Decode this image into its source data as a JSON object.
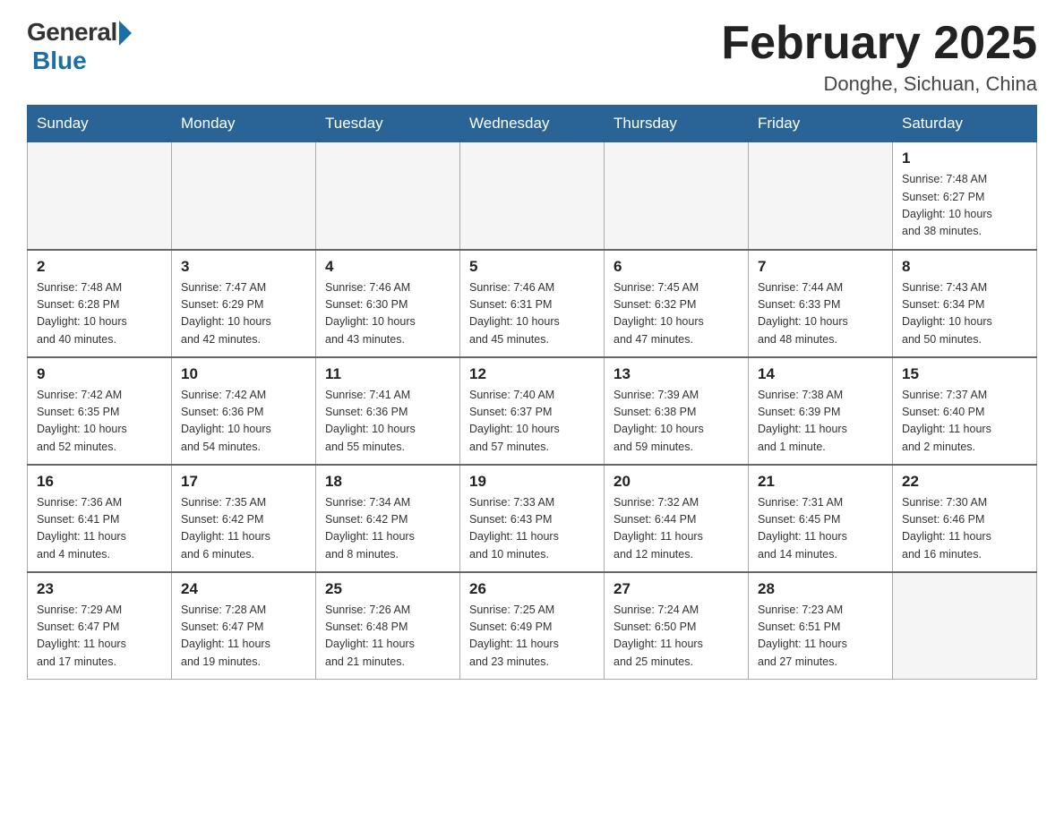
{
  "header": {
    "logo_general": "General",
    "logo_blue": "Blue",
    "title": "February 2025",
    "subtitle": "Donghe, Sichuan, China"
  },
  "days_of_week": [
    "Sunday",
    "Monday",
    "Tuesday",
    "Wednesday",
    "Thursday",
    "Friday",
    "Saturday"
  ],
  "weeks": [
    [
      {
        "day": "",
        "info": ""
      },
      {
        "day": "",
        "info": ""
      },
      {
        "day": "",
        "info": ""
      },
      {
        "day": "",
        "info": ""
      },
      {
        "day": "",
        "info": ""
      },
      {
        "day": "",
        "info": ""
      },
      {
        "day": "1",
        "info": "Sunrise: 7:48 AM\nSunset: 6:27 PM\nDaylight: 10 hours\nand 38 minutes."
      }
    ],
    [
      {
        "day": "2",
        "info": "Sunrise: 7:48 AM\nSunset: 6:28 PM\nDaylight: 10 hours\nand 40 minutes."
      },
      {
        "day": "3",
        "info": "Sunrise: 7:47 AM\nSunset: 6:29 PM\nDaylight: 10 hours\nand 42 minutes."
      },
      {
        "day": "4",
        "info": "Sunrise: 7:46 AM\nSunset: 6:30 PM\nDaylight: 10 hours\nand 43 minutes."
      },
      {
        "day": "5",
        "info": "Sunrise: 7:46 AM\nSunset: 6:31 PM\nDaylight: 10 hours\nand 45 minutes."
      },
      {
        "day": "6",
        "info": "Sunrise: 7:45 AM\nSunset: 6:32 PM\nDaylight: 10 hours\nand 47 minutes."
      },
      {
        "day": "7",
        "info": "Sunrise: 7:44 AM\nSunset: 6:33 PM\nDaylight: 10 hours\nand 48 minutes."
      },
      {
        "day": "8",
        "info": "Sunrise: 7:43 AM\nSunset: 6:34 PM\nDaylight: 10 hours\nand 50 minutes."
      }
    ],
    [
      {
        "day": "9",
        "info": "Sunrise: 7:42 AM\nSunset: 6:35 PM\nDaylight: 10 hours\nand 52 minutes."
      },
      {
        "day": "10",
        "info": "Sunrise: 7:42 AM\nSunset: 6:36 PM\nDaylight: 10 hours\nand 54 minutes."
      },
      {
        "day": "11",
        "info": "Sunrise: 7:41 AM\nSunset: 6:36 PM\nDaylight: 10 hours\nand 55 minutes."
      },
      {
        "day": "12",
        "info": "Sunrise: 7:40 AM\nSunset: 6:37 PM\nDaylight: 10 hours\nand 57 minutes."
      },
      {
        "day": "13",
        "info": "Sunrise: 7:39 AM\nSunset: 6:38 PM\nDaylight: 10 hours\nand 59 minutes."
      },
      {
        "day": "14",
        "info": "Sunrise: 7:38 AM\nSunset: 6:39 PM\nDaylight: 11 hours\nand 1 minute."
      },
      {
        "day": "15",
        "info": "Sunrise: 7:37 AM\nSunset: 6:40 PM\nDaylight: 11 hours\nand 2 minutes."
      }
    ],
    [
      {
        "day": "16",
        "info": "Sunrise: 7:36 AM\nSunset: 6:41 PM\nDaylight: 11 hours\nand 4 minutes."
      },
      {
        "day": "17",
        "info": "Sunrise: 7:35 AM\nSunset: 6:42 PM\nDaylight: 11 hours\nand 6 minutes."
      },
      {
        "day": "18",
        "info": "Sunrise: 7:34 AM\nSunset: 6:42 PM\nDaylight: 11 hours\nand 8 minutes."
      },
      {
        "day": "19",
        "info": "Sunrise: 7:33 AM\nSunset: 6:43 PM\nDaylight: 11 hours\nand 10 minutes."
      },
      {
        "day": "20",
        "info": "Sunrise: 7:32 AM\nSunset: 6:44 PM\nDaylight: 11 hours\nand 12 minutes."
      },
      {
        "day": "21",
        "info": "Sunrise: 7:31 AM\nSunset: 6:45 PM\nDaylight: 11 hours\nand 14 minutes."
      },
      {
        "day": "22",
        "info": "Sunrise: 7:30 AM\nSunset: 6:46 PM\nDaylight: 11 hours\nand 16 minutes."
      }
    ],
    [
      {
        "day": "23",
        "info": "Sunrise: 7:29 AM\nSunset: 6:47 PM\nDaylight: 11 hours\nand 17 minutes."
      },
      {
        "day": "24",
        "info": "Sunrise: 7:28 AM\nSunset: 6:47 PM\nDaylight: 11 hours\nand 19 minutes."
      },
      {
        "day": "25",
        "info": "Sunrise: 7:26 AM\nSunset: 6:48 PM\nDaylight: 11 hours\nand 21 minutes."
      },
      {
        "day": "26",
        "info": "Sunrise: 7:25 AM\nSunset: 6:49 PM\nDaylight: 11 hours\nand 23 minutes."
      },
      {
        "day": "27",
        "info": "Sunrise: 7:24 AM\nSunset: 6:50 PM\nDaylight: 11 hours\nand 25 minutes."
      },
      {
        "day": "28",
        "info": "Sunrise: 7:23 AM\nSunset: 6:51 PM\nDaylight: 11 hours\nand 27 minutes."
      },
      {
        "day": "",
        "info": ""
      }
    ]
  ]
}
